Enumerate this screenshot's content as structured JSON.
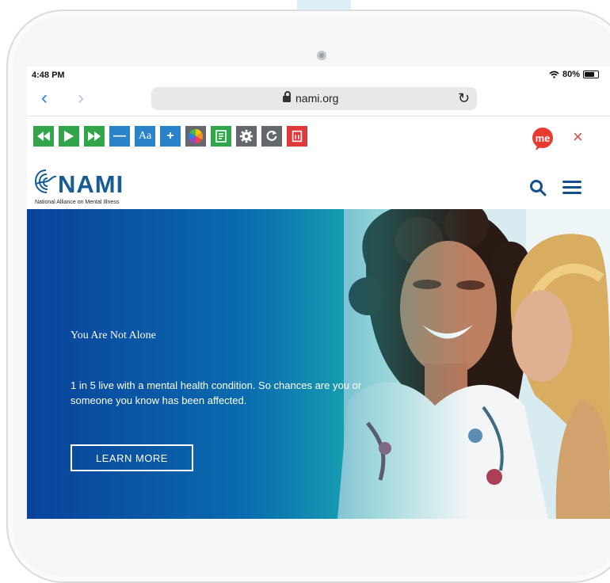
{
  "status_bar": {
    "time": "4:48 PM",
    "battery": "80%",
    "battery_level": 0.8
  },
  "browser": {
    "url": "nami.org",
    "icons": {
      "back": "chevron-left-icon",
      "forward": "chevron-right-icon",
      "lock": "lock-icon",
      "reload": "reload-icon"
    }
  },
  "accessibility_toolbar": {
    "items": [
      {
        "name": "rewind-button",
        "icon": "rewind-icon"
      },
      {
        "name": "play-button",
        "icon": "play-icon"
      },
      {
        "name": "fast-forward-button",
        "icon": "fast-forward-icon"
      },
      {
        "name": "decrease-text-button",
        "icon": "minus-icon"
      },
      {
        "name": "text-size-button",
        "label": "Aa",
        "icon": "text-size-icon"
      },
      {
        "name": "increase-text-button",
        "icon": "plus-icon"
      },
      {
        "name": "color-wheel-button",
        "icon": "color-wheel-icon"
      },
      {
        "name": "reading-mode-button",
        "icon": "document-icon"
      },
      {
        "name": "settings-button",
        "icon": "gear-icon"
      },
      {
        "name": "reset-button",
        "icon": "refresh-icon"
      },
      {
        "name": "exit-button",
        "icon": "exit-icon"
      }
    ],
    "me_badge": "me",
    "close": "×"
  },
  "site_header": {
    "logo": "NAMI",
    "tagline": "National Alliance on Mental Illness",
    "icons": {
      "search": "search-icon",
      "menu": "menu-icon"
    }
  },
  "hero": {
    "heading": "You Are Not Alone",
    "description": "1 in 5 live with a mental health condition. So chances are you or someone you know has been affected.",
    "cta": "LEARN MORE"
  },
  "colors": {
    "toolbar_green": "#32a54a",
    "toolbar_blue": "#2a82c8",
    "toolbar_gray": "#64686d",
    "toolbar_red": "#df3838",
    "nami_blue": "#165c96",
    "hero_start": "#1252a0",
    "hero_mid": "#1ab1b0"
  }
}
